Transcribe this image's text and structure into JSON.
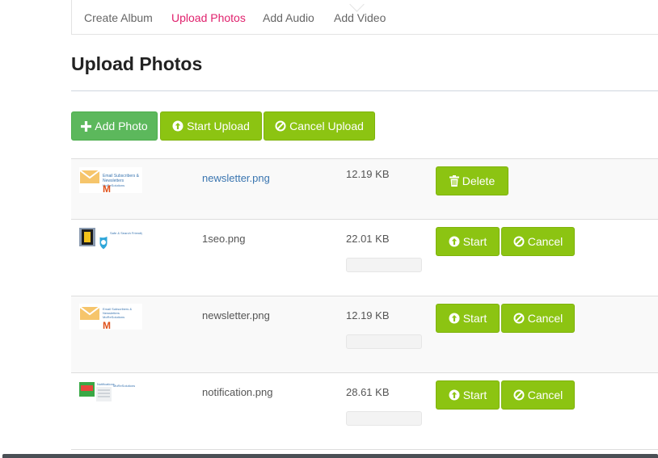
{
  "tabs": [
    {
      "label": "Create Album",
      "active": false
    },
    {
      "label": "Upload Photos",
      "active": true
    },
    {
      "label": "Add Audio",
      "active": false
    },
    {
      "label": "Add Video",
      "active": false
    }
  ],
  "page_title": "Upload Photos",
  "toolbar": {
    "add_photo": "Add Photo",
    "start_upload": "Start Upload",
    "cancel_upload": "Cancel Upload"
  },
  "files": [
    {
      "name": "newsletter.png",
      "size": "12.19 KB",
      "state": "uploaded",
      "actions": [
        "Delete"
      ]
    },
    {
      "name": "1seo.png",
      "size": "22.01 KB",
      "state": "pending",
      "progress": 0,
      "actions": [
        "Start",
        "Cancel"
      ]
    },
    {
      "name": "newsletter.png",
      "size": "12.19 KB",
      "state": "pending",
      "progress": 0,
      "actions": [
        "Start",
        "Cancel"
      ]
    },
    {
      "name": "notification.png",
      "size": "28.61 KB",
      "state": "pending",
      "progress": 0,
      "actions": [
        "Start",
        "Cancel"
      ]
    }
  ],
  "colors": {
    "active_tab": "#e0216d",
    "add_button": "#5cb85c",
    "action_button": "#8cc412",
    "link": "#3a75b0"
  },
  "icons": {
    "add_photo": "plus-icon",
    "start": "upload-circle-icon",
    "cancel": "ban-icon",
    "delete": "trash-icon"
  }
}
